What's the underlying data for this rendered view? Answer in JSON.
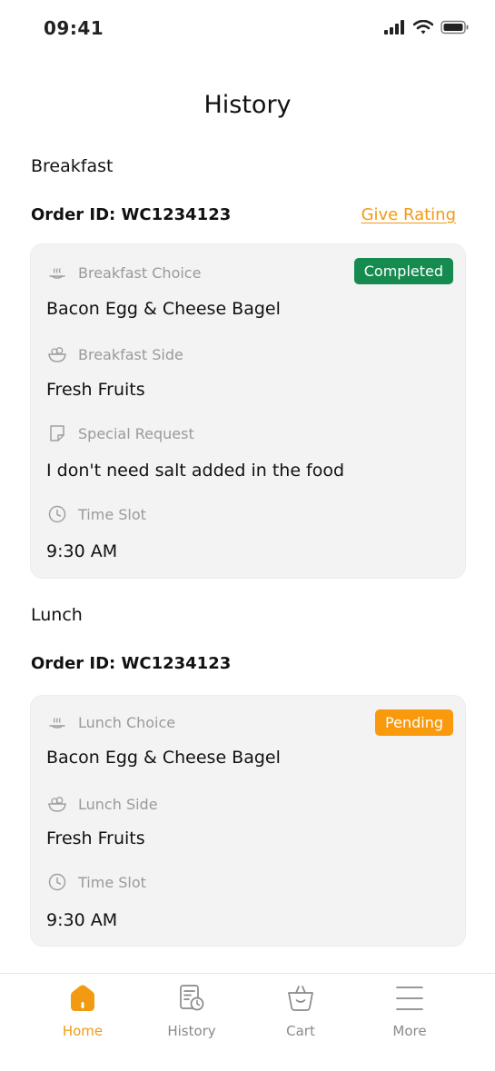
{
  "status_bar": {
    "time": "09:41"
  },
  "page": {
    "title": "History"
  },
  "breakfast": {
    "section_label": "Breakfast",
    "order_id": "Order ID: WC1234123",
    "rating_link": "Give Rating",
    "status": "Completed",
    "choice_label": "Breakfast Choice",
    "choice_value": "Bacon Egg & Cheese Bagel",
    "side_label": "Breakfast Side",
    "side_value": "Fresh Fruits",
    "request_label": "Special Request",
    "request_value": "I don't need salt added in the food",
    "slot_label": "Time Slot",
    "slot_value": "9:30 AM"
  },
  "lunch": {
    "section_label": "Lunch",
    "order_id": "Order ID: WC1234123",
    "status": "Pending",
    "choice_label": "Lunch Choice",
    "choice_value": "Bacon Egg & Cheese Bagel",
    "side_label": "Lunch Side",
    "side_value": "Fresh Fruits",
    "slot_label": "Time Slot",
    "slot_value": "9:30 AM"
  },
  "nav": {
    "items": [
      {
        "label": "Home",
        "icon": "home-icon",
        "active": true
      },
      {
        "label": "History",
        "icon": "history-icon",
        "active": false
      },
      {
        "label": "Cart",
        "icon": "cart-icon",
        "active": false
      },
      {
        "label": "More",
        "icon": "menu-icon",
        "active": false
      }
    ]
  },
  "colors": {
    "accent": "#F29A12",
    "completed": "#168B4F",
    "pending": "#F89A0C",
    "card_bg": "#F3F3F3"
  }
}
